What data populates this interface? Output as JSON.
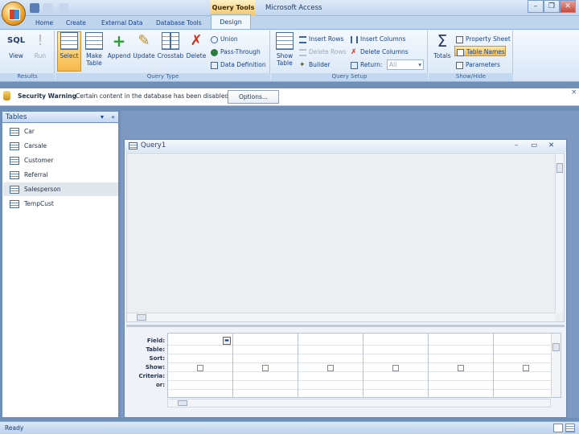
{
  "app": {
    "title": "Microsoft Access",
    "contextual_tab": "Query Tools",
    "window_controls": [
      "minimize",
      "restore",
      "close"
    ]
  },
  "tabs": [
    "Home",
    "Create",
    "External Data",
    "Database Tools",
    "Design"
  ],
  "ribbon": {
    "results": {
      "group": "Results",
      "sql": "SQL",
      "view": "View",
      "run": "Run"
    },
    "query_type": {
      "group": "Query Type",
      "select": "Select",
      "make_table_1": "Make",
      "make_table_2": "Table",
      "append": "Append",
      "update": "Update",
      "crosstab": "Crosstab",
      "delete": "Delete",
      "union": "Union",
      "pass_through": "Pass-Through",
      "data_definition": "Data Definition"
    },
    "query_setup": {
      "group": "Query Setup",
      "show_table_1": "Show",
      "show_table_2": "Table",
      "insert_rows": "Insert Rows",
      "delete_rows": "Delete Rows",
      "builder": "Builder",
      "insert_columns": "Insert Columns",
      "delete_columns": "Delete Columns",
      "return": "Return:",
      "return_value": "All"
    },
    "show_hide": {
      "group": "Show/Hide",
      "totals": "Totals",
      "property_sheet": "Property Sheet",
      "table_names": "Table Names",
      "parameters": "Parameters"
    }
  },
  "security": {
    "label": "Security Warning",
    "message": "Certain content in the database has been disabled",
    "button": "Options..."
  },
  "nav": {
    "title": "Tables",
    "items": [
      "Car",
      "Carsale",
      "Customer",
      "Referral",
      "Salesperson",
      "TempCust"
    ]
  },
  "query": {
    "title": "Query1",
    "row_labels": [
      "Field:",
      "Table:",
      "Sort:",
      "Show:",
      "Criteria:",
      "or:"
    ]
  },
  "status": {
    "text": "Ready"
  },
  "colors": {
    "accent": "#15428b",
    "selected": "#f2c46b"
  }
}
